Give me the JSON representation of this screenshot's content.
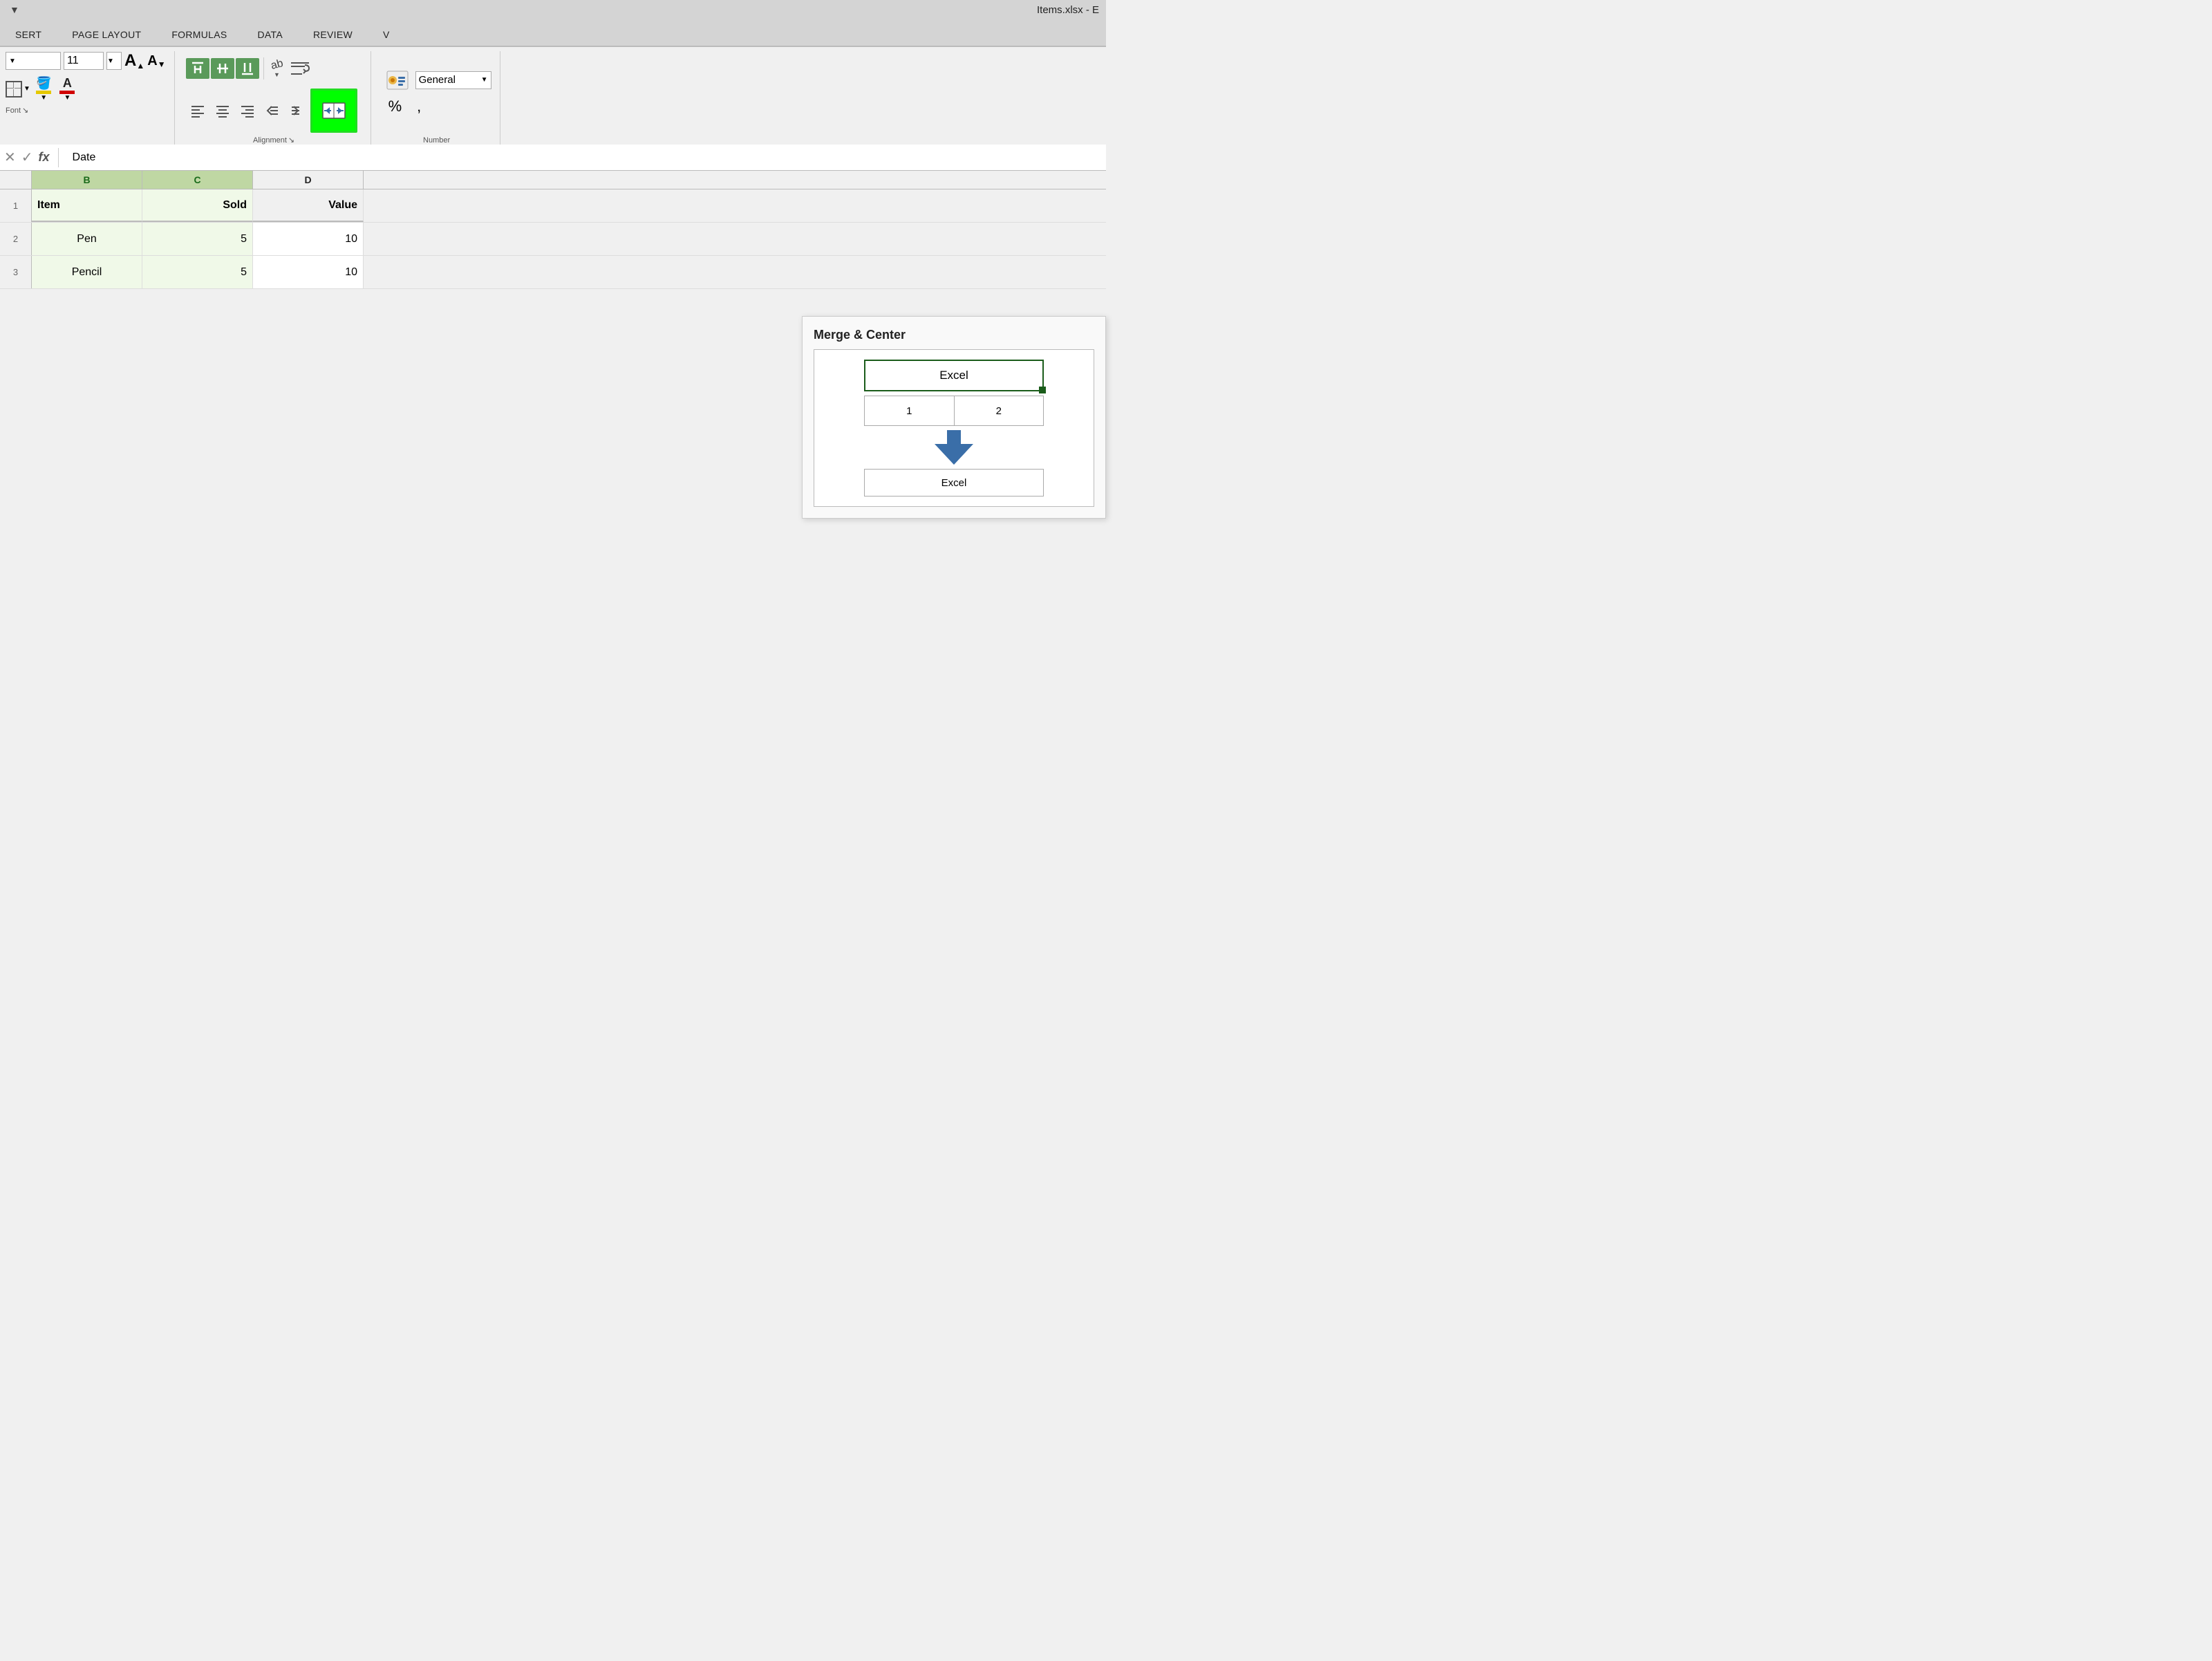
{
  "titlebar": {
    "quick_access_arrow": "▼",
    "title": "Items.xlsx - E"
  },
  "tabs": {
    "items": [
      "SERT",
      "PAGE LAYOUT",
      "FORMULAS",
      "DATA",
      "REVIEW",
      "V"
    ]
  },
  "ribbon": {
    "font_section_label": "Font",
    "font_expand_icon": "↘",
    "alignment_section_label": "Alignment",
    "alignment_expand_icon": "↘",
    "number_section_label": "Number",
    "font_size": "11",
    "big_a_up": "A▲",
    "big_a_down": "A▼",
    "general_label": "General",
    "wrap_text_label": "Wrap Text",
    "merge_center_label": "Merge & Center",
    "percent_label": "%",
    "comma_label": ","
  },
  "formula_bar": {
    "cancel_label": "✕",
    "confirm_label": "✓",
    "fx_label": "fx",
    "cell_content": "Date"
  },
  "spreadsheet": {
    "columns": [
      "B",
      "C",
      "D"
    ],
    "header_row": {
      "b": "Item",
      "c": "Sold",
      "d": "Value"
    },
    "rows": [
      {
        "num": "1",
        "b": "Item",
        "c": "Sold",
        "d": "Value"
      },
      {
        "num": "2",
        "b": "Pen",
        "c": "5",
        "d": "10"
      },
      {
        "num": "3",
        "b": "Pencil",
        "c": "5",
        "d": "10"
      }
    ]
  },
  "merge_tooltip": {
    "title": "Merge & Center",
    "excel_label": "Excel",
    "num1": "1",
    "num2": "2",
    "excel_result": "Excel"
  }
}
